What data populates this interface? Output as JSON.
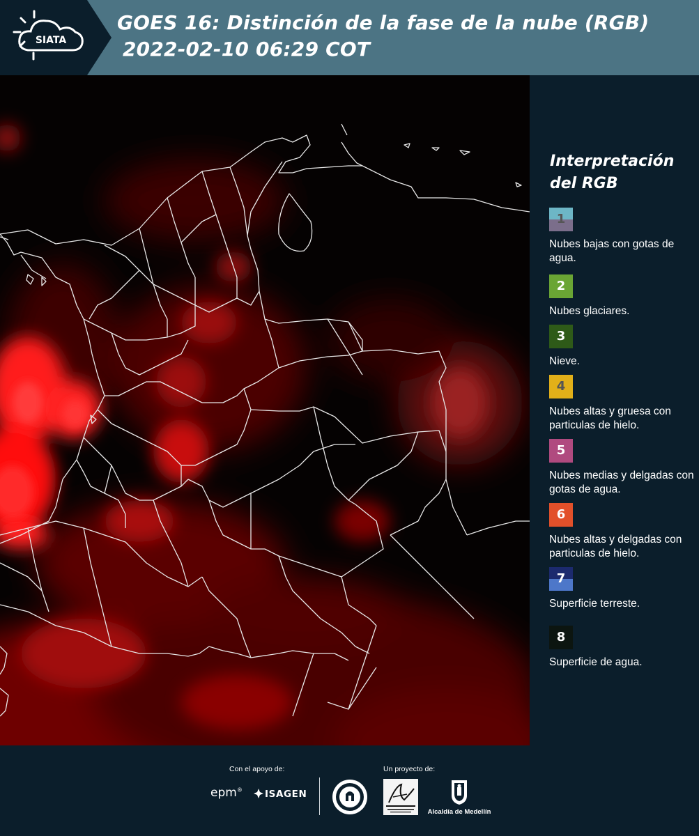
{
  "header": {
    "logo_text": "SIATA",
    "title_line1": "GOES 16: Distinción de la fase de la nube (RGB)",
    "title_line2": "2022-02-10 06:29 COT"
  },
  "legend": {
    "title_line1": "Interpretación",
    "title_line2": "del RGB",
    "items": [
      {
        "number": "1",
        "label": "Nubes bajas con gotas de agua.",
        "color_top": "#6db6c6",
        "color_bottom": "#7b6e8b",
        "num_color": "#555555"
      },
      {
        "number": "2",
        "label": "Nubes glaciares.",
        "color_top": "#6aa534",
        "color_bottom": "#6aa534",
        "num_color": "#ffffff"
      },
      {
        "number": "3",
        "label": "Nieve.",
        "color_top": "#2e5a18",
        "color_bottom": "#2e5a18",
        "num_color": "#ffffff"
      },
      {
        "number": "4",
        "label": "Nubes altas y gruesa con particulas de hielo.",
        "color_top": "#e2b019",
        "color_bottom": "#e2b019",
        "num_color": "#555555"
      },
      {
        "number": "5",
        "label": "Nubes medias y delgadas con gotas de agua.",
        "color_top": "#b04a7f",
        "color_bottom": "#b04a7f",
        "num_color": "#ffffff"
      },
      {
        "number": "6",
        "label": "Nubes altas y delgadas con particulas de hielo.",
        "color_top": "#e2502a",
        "color_bottom": "#e2502a",
        "num_color": "#ffffff"
      },
      {
        "number": "7",
        "label": "Superficie terreste.",
        "color_top": "#1c2a6e",
        "color_bottom": "#4d77c9",
        "num_color": "#ffffff"
      },
      {
        "number": "8",
        "label": "Superficie de agua.",
        "color_top": "#0c1510",
        "color_bottom": "#0c1510",
        "num_color": "#ffffff",
        "border": "#ffffff"
      }
    ]
  },
  "footer": {
    "support_caption": "Con el apoyo de:",
    "project_caption": "Un proyecto de:",
    "epm": "epm",
    "isagen": "ISAGEN",
    "alcaldia": "Alcaldía de Medellín"
  }
}
